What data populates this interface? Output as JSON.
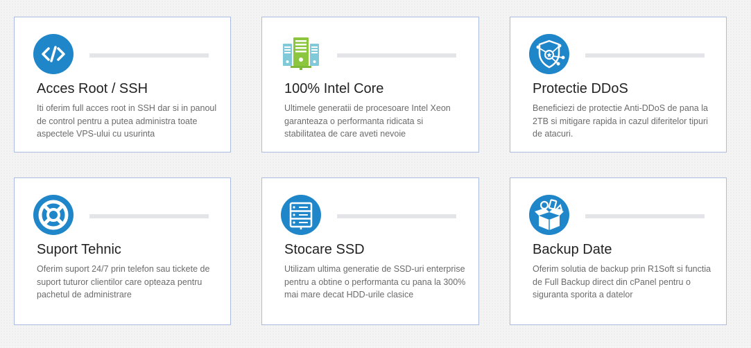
{
  "features": [
    {
      "title": "Acces Root / SSH",
      "description": "Iti oferim full acces root in SSH dar si in panoul de control pentru a putea administra toate aspectele VPS-ului cu usurinta",
      "icon": "code-icon"
    },
    {
      "title": "100% Intel Core",
      "description": "Ultimele generatii de procesoare Intel Xeon garanteaza o performanta ridicata si stabilitatea de care aveti nevoie",
      "icon": "server-towers-icon"
    },
    {
      "title": "Protectie DDoS",
      "description": "Beneficiezi de protectie Anti-DDoS de pana la 2TB si mitigare rapida in cazul diferitelor tipuri de atacuri.",
      "icon": "shield-network-icon"
    },
    {
      "title": "Suport Tehnic",
      "description": "Oferim suport 24/7 prin telefon sau tickete de suport tuturor clientilor care opteaza pentru pachetul de administrare",
      "icon": "lifebuoy-icon"
    },
    {
      "title": "Stocare SSD",
      "description": "Utilizam ultima generatie de SSD-uri enterprise pentru a obtine o performanta cu pana la 300% mai mare decat HDD-urile clasice",
      "icon": "storage-rack-icon"
    },
    {
      "title": "Backup Date",
      "description": "Oferim solutia de backup prin R1Soft si functia de Full Backup direct din cPanel pentru o siguranta sporita a datelor",
      "icon": "backup-box-icon"
    }
  ],
  "colors": {
    "accent": "#1f86c9",
    "card_border": "#a9bbe0",
    "title": "#222222",
    "text": "#6b6b6b"
  }
}
